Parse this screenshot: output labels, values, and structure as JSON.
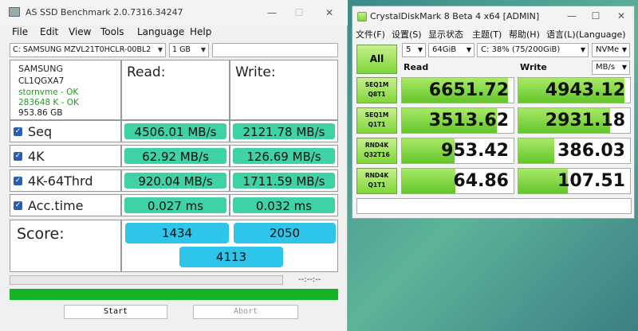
{
  "asssd": {
    "title": "AS SSD Benchmark 2.0.7316.34247",
    "menu": [
      "File",
      "Edit",
      "View",
      "Tools",
      "Language",
      "Help"
    ],
    "drive_select": "C: SAMSUNG MZVL21T0HCLR-00BL2",
    "size_select": "1 GB",
    "info": {
      "vendor": "SAMSUNG",
      "firmware": "CL1QGXA7",
      "driver": "stornvme - OK",
      "alignment": "283648 K - OK",
      "capacity": "953.86 GB"
    },
    "columns": {
      "read": "Read:",
      "write": "Write:"
    },
    "rows": [
      {
        "label": "Seq",
        "read": "4506.01 MB/s",
        "write": "2121.78 MB/s"
      },
      {
        "label": "4K",
        "read": "62.92 MB/s",
        "write": "126.69 MB/s"
      },
      {
        "label": "4K-64Thrd",
        "read": "920.04 MB/s",
        "write": "1711.59 MB/s"
      },
      {
        "label": "Acc.time",
        "read": "0.027 ms",
        "write": "0.032 ms"
      }
    ],
    "score": {
      "label": "Score:",
      "read": "1434",
      "write": "2050",
      "total": "4113"
    },
    "elapsed": "--:--:--",
    "progress_fraction": 1.0,
    "buttons": {
      "start": "Start",
      "abort": "Abort"
    },
    "checkbox_mark": "✓",
    "accent_green": "#16b327",
    "value_color": "#3fd2a7",
    "score_color": "#2fc5ea"
  },
  "cdm": {
    "title": "CrystalDiskMark 8 Beta 4 x64 [ADMIN]",
    "menu": [
      "文件(F)",
      "设置(S)",
      "显示状态",
      "主题(T)",
      "帮助(H)",
      "语言(L)(Language)"
    ],
    "all_label": "All",
    "count": "5",
    "size": "64GiB",
    "drive": "C: 38% (75/200GiB)",
    "mode": "NVMe",
    "unit": "MB/s",
    "col_read": "Read",
    "col_write": "Write",
    "tests": [
      {
        "line1": "SEQ1M",
        "line2": "Q8T1",
        "read": "6651.72",
        "write": "4943.12",
        "read_fill": 0.95,
        "write_fill": 0.95
      },
      {
        "line1": "SEQ1M",
        "line2": "Q1T1",
        "read": "3513.62",
        "write": "2931.18",
        "read_fill": 0.85,
        "write_fill": 0.82
      },
      {
        "line1": "RND4K",
        "line2": "Q32T16",
        "read": "953.42",
        "write": "386.03",
        "read_fill": 0.47,
        "write_fill": 0.32
      },
      {
        "line1": "RND4K",
        "line2": "Q1T1",
        "read": "64.86",
        "write": "107.51",
        "read_fill": 0.48,
        "write_fill": 0.44
      }
    ],
    "status": "",
    "accent_green": "#7fd638"
  }
}
